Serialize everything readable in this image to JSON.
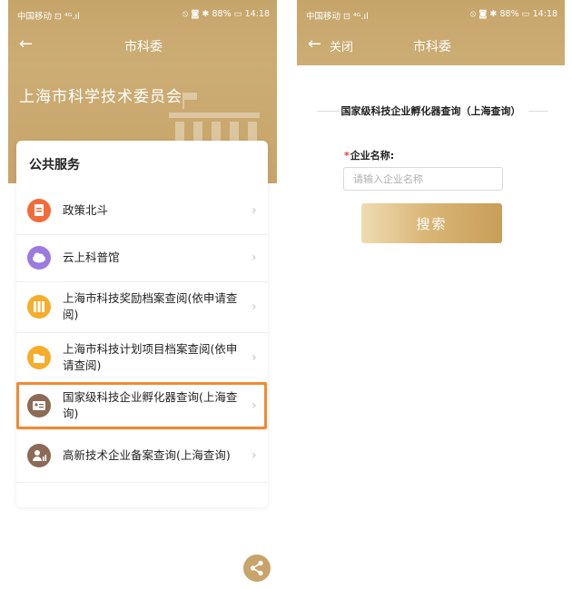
{
  "status_bar": {
    "left_text": "中国移动 ⊡ ⁴ᴳ.ıl",
    "right_text": "⦸ ◙ ✱ 88% ▭ 14:18"
  },
  "left_screen": {
    "nav_title": "市科委",
    "hero_title": "上海市科学技术委员会",
    "card_title": "公共服务",
    "items": [
      {
        "label": "政策北斗",
        "icon": "document-icon",
        "color": "#f26b3a"
      },
      {
        "label": "云上科普馆",
        "icon": "cloud-icon",
        "color": "#9b7be0"
      },
      {
        "label": "上海市科技奖励档案查阅(依申请查阅)",
        "icon": "archive-icon",
        "color": "#f6ad2c"
      },
      {
        "label": "上海市科技计划项目档案查阅(依申请查阅)",
        "icon": "folder-icon",
        "color": "#f6ad2c"
      },
      {
        "label": "国家级科技企业孵化器查询(上海查询)",
        "icon": "id-card-icon",
        "color": "#8c6a56"
      },
      {
        "label": "高新技术企业备案查询(上海查询)",
        "icon": "user-chart-icon",
        "color": "#8c6a56"
      }
    ],
    "highlight_color": "#f08a32",
    "share_icon": "share-icon"
  },
  "right_screen": {
    "close_label": "关闭",
    "nav_title": "市科委",
    "section_title": "国家级科技企业孵化器查询（上海查询）",
    "field_required_mark": "*",
    "field_label": "企业名称:",
    "field_placeholder": "请输入企业名称",
    "field_value": "",
    "search_label": "搜索"
  },
  "colors": {
    "brand_gold": "#c8a46b",
    "required_red": "#e53935"
  }
}
